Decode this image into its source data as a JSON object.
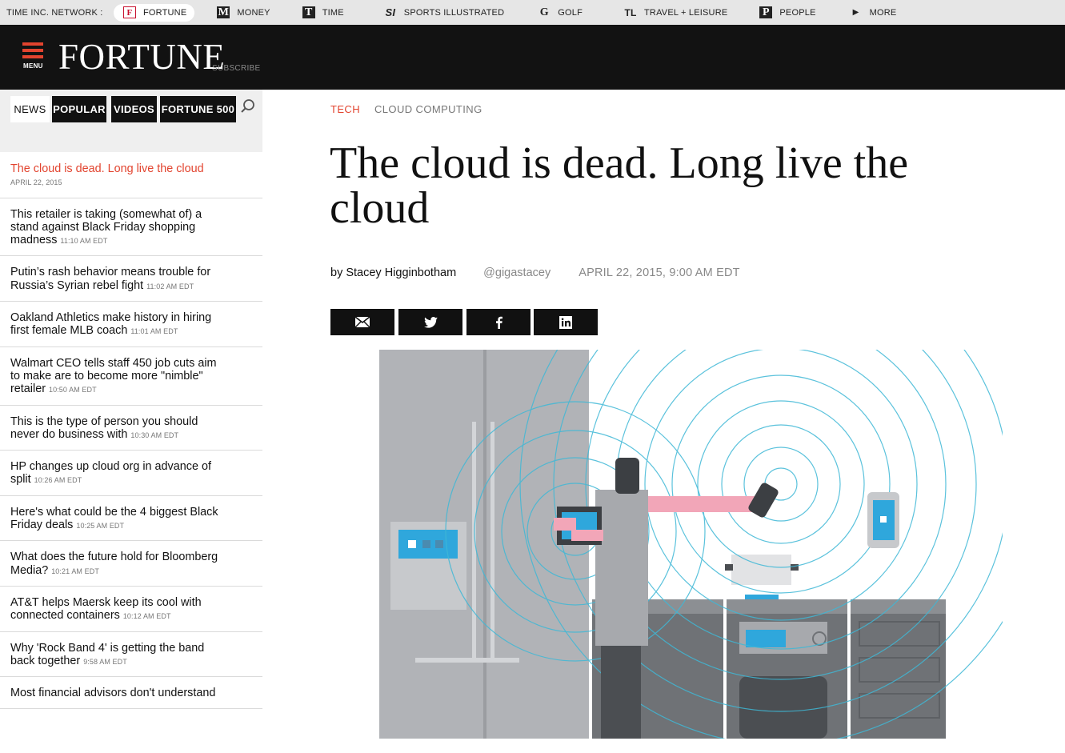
{
  "network": {
    "label": "TIME INC. NETWORK :",
    "items": [
      {
        "label": "FORTUNE",
        "glyph": "F",
        "active": true
      },
      {
        "label": "MONEY",
        "glyph": "M"
      },
      {
        "label": "TIME",
        "glyph": "T"
      },
      {
        "label": "SPORTS ILLUSTRATED",
        "glyph": "SI"
      },
      {
        "label": "GOLF",
        "glyph": "G"
      },
      {
        "label": "TRAVEL + LEISURE",
        "glyph": "TL"
      },
      {
        "label": "PEOPLE",
        "glyph": "P"
      },
      {
        "label": "MORE",
        "glyph": "▶"
      }
    ]
  },
  "header": {
    "menu_label": "MENU",
    "logo": "FORTUNE",
    "subscribe": "SUBSCRIBE"
  },
  "sidebar": {
    "tabs": [
      {
        "label": "NEWS",
        "active": true
      },
      {
        "label": "POPULAR"
      },
      {
        "label": "VIDEOS"
      },
      {
        "label": "FORTUNE 500"
      }
    ],
    "items": [
      {
        "title": "The cloud is dead. Long live the cloud",
        "time": "APRIL 22, 2015",
        "current": true
      },
      {
        "title": "This retailer is taking (somewhat of) a stand against Black Friday shopping madness",
        "time": "11:10 AM EDT"
      },
      {
        "title": "Putin’s rash behavior means trouble for Russia’s Syrian rebel fight",
        "time": "11:02 AM EDT"
      },
      {
        "title": "Oakland Athletics make history in hiring first female MLB coach",
        "time": "11:01 AM EDT"
      },
      {
        "title": "Walmart CEO tells staff 450 job cuts aim to make are to become more \"nimble\" retailer",
        "time": "10:50 AM EDT"
      },
      {
        "title": "This is the type of person you should never do business with",
        "time": "10:30 AM EDT"
      },
      {
        "title": "HP changes up cloud org in advance of split",
        "time": "10:26 AM EDT"
      },
      {
        "title": "Here's what could be the 4 biggest Black Friday deals",
        "time": "10:25 AM EDT"
      },
      {
        "title": "What does the future hold for Bloomberg Media?",
        "time": "10:21 AM EDT"
      },
      {
        "title": "AT&T helps Maersk keep its cool with connected containers",
        "time": "10:12 AM EDT"
      },
      {
        "title": "Why 'Rock Band 4' is getting the band back together",
        "time": "9:58 AM EDT"
      },
      {
        "title": "Most financial advisors don't understand",
        "time": ""
      }
    ]
  },
  "article": {
    "category": "TECH",
    "subcategory": "CLOUD COMPUTING",
    "headline": "The cloud is dead. Long live the cloud",
    "author": "by Stacey Higginbotham",
    "handle": "@gigastacey",
    "date": "APRIL 22, 2015, 9:00 AM EDT",
    "share": [
      "email-icon",
      "twitter-icon",
      "facebook-icon",
      "linkedin-icon"
    ]
  },
  "colors": {
    "accent": "#e2442f",
    "header_bg": "#121212",
    "wave": "#3fb8d6"
  }
}
